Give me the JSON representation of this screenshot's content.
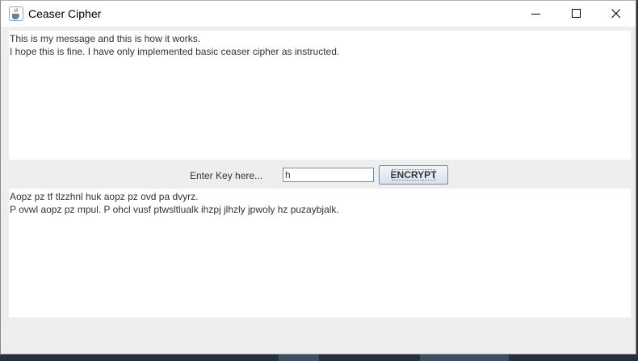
{
  "window": {
    "title": "Ceaser Cipher",
    "app_icon": "java-coffee-cup-icon",
    "controls": {
      "minimize_icon": "minimize-icon",
      "maximize_icon": "maximize-icon",
      "close_icon": "close-icon"
    }
  },
  "input_area": {
    "text": "This is my message and this is how it works.\nI hope this is fine. I have only implemented basic ceaser cipher as instructed."
  },
  "key_row": {
    "label": "Enter Key here...",
    "key_value": "h",
    "button_label": "ENCRYPT"
  },
  "output_area": {
    "text": "Aopz pz tf tlzzhnl huk aopz pz ovd pa dvyrz.\nP ovwl aopz pz mpul. P ohcl vusf ptwsltlualk ihzpj jlhzly jpwoly hz puzaybjalk."
  },
  "colors": {
    "window_bg": "#eeeeee",
    "titlebar_bg": "#ffffff",
    "text": "#333333",
    "button_border": "#7a8a99"
  }
}
